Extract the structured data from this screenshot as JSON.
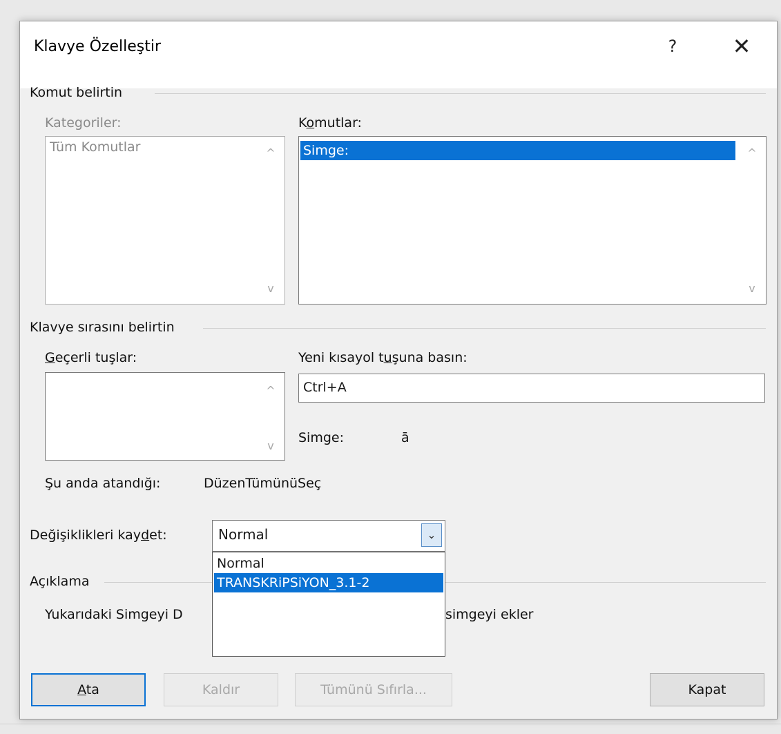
{
  "dialog": {
    "title": "Klavye Özelleştir",
    "help_label": "?",
    "close_label": "✕"
  },
  "command_group": {
    "label": "Komut belirtin",
    "categories_label": "Kategoriler:",
    "categories_items": [
      "Tüm Komutlar"
    ],
    "commands_label_pre": "K",
    "commands_label_u": "o",
    "commands_label_post": "mutlar:",
    "commands_items": [
      "Simge:"
    ],
    "scroll_up": "^",
    "scroll_down": "v"
  },
  "keyboard_group": {
    "label": "Klavye sırasını belirtin",
    "current_keys_label_u": "G",
    "current_keys_label_post": "eçerli tuşlar:",
    "new_shortcut_label_pre": "Yeni kısayol t",
    "new_shortcut_label_u": "u",
    "new_shortcut_label_post": "şuna basın:",
    "new_shortcut_value": "Ctrl+A",
    "symbol_label": "Simge:",
    "symbol_value": "ā",
    "assigned_label": "Şu anda atandığı:",
    "assigned_value": "DüzenTümünüSeç"
  },
  "save_changes": {
    "label_pre": "Değişiklikleri kay",
    "label_u": "d",
    "label_post": "et:",
    "selected": "Normal",
    "options": [
      "Normal",
      "TRANSKRiPSiYON_3.1-2"
    ],
    "highlighted_index": 1,
    "chevron": "⌄"
  },
  "description": {
    "label": "Açıklama",
    "text_left": "Yukarıdaki Simgeyi D",
    "text_right": "simgeyi ekler"
  },
  "buttons": {
    "assign_u": "A",
    "assign_post": "ta",
    "remove": "Kaldır",
    "reset_all": "Tümünü Sıfırla...",
    "close": "Kapat"
  },
  "colors": {
    "selection": "#0a72d4",
    "dialog_bg": "#f0f0f0"
  }
}
